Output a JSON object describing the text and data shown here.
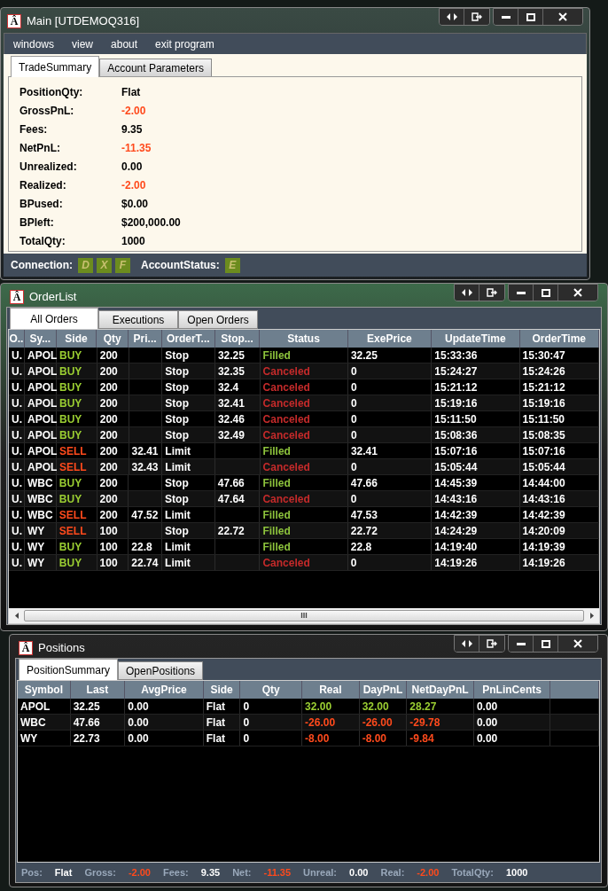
{
  "main": {
    "icon_glyph": "Â",
    "title": "Main [UTDEMOQ316]",
    "menu": [
      "windows",
      "view",
      "about",
      "exit program"
    ],
    "tabs": [
      {
        "label": "TradeSummary",
        "selected": true
      },
      {
        "label": "Account Parameters",
        "selected": false
      }
    ],
    "summary": [
      {
        "label": "PositionQty:",
        "value": "Flat",
        "negative": false
      },
      {
        "label": "GrossPnL:",
        "value": "-2.00",
        "negative": true
      },
      {
        "label": "Fees:",
        "value": "9.35",
        "negative": false
      },
      {
        "label": "NetPnL:",
        "value": "-11.35",
        "negative": true
      },
      {
        "label": "Unrealized:",
        "value": "0.00",
        "negative": false
      },
      {
        "label": "Realized:",
        "value": "-2.00",
        "negative": true
      },
      {
        "label": "BPused:",
        "value": "$0.00",
        "negative": false
      },
      {
        "label": "BPleft:",
        "value": "$200,000.00",
        "negative": false
      },
      {
        "label": "TotalQty:",
        "value": "1000",
        "negative": false
      }
    ],
    "status_bar": {
      "connection_label": "Connection:",
      "connection_flags": [
        "D",
        "X",
        "F"
      ],
      "account_label": "AccountStatus:",
      "account_flags": [
        "E"
      ]
    }
  },
  "orders": {
    "icon_glyph": "Â",
    "title": "OrderList",
    "tabs": [
      {
        "label": "All Orders",
        "selected": true
      },
      {
        "label": "Executions",
        "selected": false
      },
      {
        "label": "Open Orders",
        "selected": false
      }
    ],
    "columns": [
      "O..",
      "Sy...",
      "Side",
      "Qty",
      "Pri...",
      "OrderT...",
      "Stop...",
      "Status",
      "ExePrice",
      "UpdateTime",
      "OrderTime"
    ],
    "rows": [
      {
        "sell": false,
        "filled": true,
        "cells": [
          "U.",
          "APOL",
          "BUY",
          "200",
          "",
          "Stop",
          "32.25",
          "Filled",
          "32.25",
          "15:33:36",
          "15:30:47"
        ]
      },
      {
        "sell": false,
        "filled": false,
        "cells": [
          "U.",
          "APOL",
          "BUY",
          "200",
          "",
          "Stop",
          "32.35",
          "Canceled",
          "0",
          "15:24:27",
          "15:24:26"
        ]
      },
      {
        "sell": false,
        "filled": false,
        "cells": [
          "U.",
          "APOL",
          "BUY",
          "200",
          "",
          "Stop",
          "32.4",
          "Canceled",
          "0",
          "15:21:12",
          "15:21:12"
        ]
      },
      {
        "sell": false,
        "filled": false,
        "cells": [
          "U.",
          "APOL",
          "BUY",
          "200",
          "",
          "Stop",
          "32.41",
          "Canceled",
          "0",
          "15:19:16",
          "15:19:16"
        ]
      },
      {
        "sell": false,
        "filled": false,
        "cells": [
          "U.",
          "APOL",
          "BUY",
          "200",
          "",
          "Stop",
          "32.46",
          "Canceled",
          "0",
          "15:11:50",
          "15:11:50"
        ]
      },
      {
        "sell": false,
        "filled": false,
        "cells": [
          "U.",
          "APOL",
          "BUY",
          "200",
          "",
          "Stop",
          "32.49",
          "Canceled",
          "0",
          "15:08:36",
          "15:08:35"
        ]
      },
      {
        "sell": true,
        "filled": true,
        "cells": [
          "U.",
          "APOL",
          "SELL",
          "200",
          "32.41",
          "Limit",
          "",
          "Filled",
          "32.41",
          "15:07:16",
          "15:07:16"
        ]
      },
      {
        "sell": true,
        "filled": false,
        "cells": [
          "U.",
          "APOL",
          "SELL",
          "200",
          "32.43",
          "Limit",
          "",
          "Canceled",
          "0",
          "15:05:44",
          "15:05:44"
        ]
      },
      {
        "sell": false,
        "filled": true,
        "cells": [
          "U.",
          "WBC",
          "BUY",
          "200",
          "",
          "Stop",
          "47.66",
          "Filled",
          "47.66",
          "14:45:39",
          "14:44:00"
        ]
      },
      {
        "sell": false,
        "filled": false,
        "cells": [
          "U.",
          "WBC",
          "BUY",
          "200",
          "",
          "Stop",
          "47.64",
          "Canceled",
          "0",
          "14:43:16",
          "14:43:16"
        ]
      },
      {
        "sell": true,
        "filled": true,
        "cells": [
          "U.",
          "WBC",
          "SELL",
          "200",
          "47.52",
          "Limit",
          "",
          "Filled",
          "47.53",
          "14:42:39",
          "14:42:39"
        ]
      },
      {
        "sell": true,
        "filled": true,
        "cells": [
          "U.",
          "WY",
          "SELL",
          "100",
          "",
          "Stop",
          "22.72",
          "Filled",
          "22.72",
          "14:24:29",
          "14:20:09"
        ]
      },
      {
        "sell": false,
        "filled": true,
        "cells": [
          "U.",
          "WY",
          "BUY",
          "100",
          "22.8",
          "Limit",
          "",
          "Filled",
          "22.8",
          "14:19:40",
          "14:19:39"
        ]
      },
      {
        "sell": false,
        "filled": false,
        "cells": [
          "U.",
          "WY",
          "BUY",
          "100",
          "22.74",
          "Limit",
          "",
          "Canceled",
          "0",
          "14:19:26",
          "14:19:26"
        ]
      }
    ],
    "scrollbar_grip": "III"
  },
  "positions": {
    "icon_glyph": "Â",
    "title": "Positions",
    "tabs": [
      {
        "label": "PositionSummary",
        "selected": true
      },
      {
        "label": "OpenPositions",
        "selected": false
      }
    ],
    "columns": [
      "Symbol",
      "Last",
      "AvgPrice",
      "Side",
      "Qty",
      "Real",
      "DayPnL",
      "NetDayPnL",
      "PnLinCents"
    ],
    "rows": [
      {
        "negative": false,
        "cells": [
          "APOL",
          "32.25",
          "0.00",
          "Flat",
          "0",
          "32.00",
          "32.00",
          "28.27",
          "0.00"
        ]
      },
      {
        "negative": true,
        "cells": [
          "WBC",
          "47.66",
          "0.00",
          "Flat",
          "0",
          "-26.00",
          "-26.00",
          "-29.78",
          "0.00"
        ]
      },
      {
        "negative": true,
        "cells": [
          "WY",
          "22.73",
          "0.00",
          "Flat",
          "0",
          "-8.00",
          "-8.00",
          "-9.84",
          "0.00"
        ]
      }
    ],
    "status_bar": [
      {
        "label": "Pos:",
        "value": "Flat",
        "negative": false
      },
      {
        "label": "Gross:",
        "value": "-2.00",
        "negative": true
      },
      {
        "label": "Fees:",
        "value": "9.35",
        "negative": false
      },
      {
        "label": "Net:",
        "value": "-11.35",
        "negative": true
      },
      {
        "label": "Unreal:",
        "value": "0.00",
        "negative": false
      },
      {
        "label": "Real:",
        "value": "-2.00",
        "negative": true
      },
      {
        "label": "TotalQty:",
        "value": "1000",
        "negative": false
      }
    ]
  }
}
